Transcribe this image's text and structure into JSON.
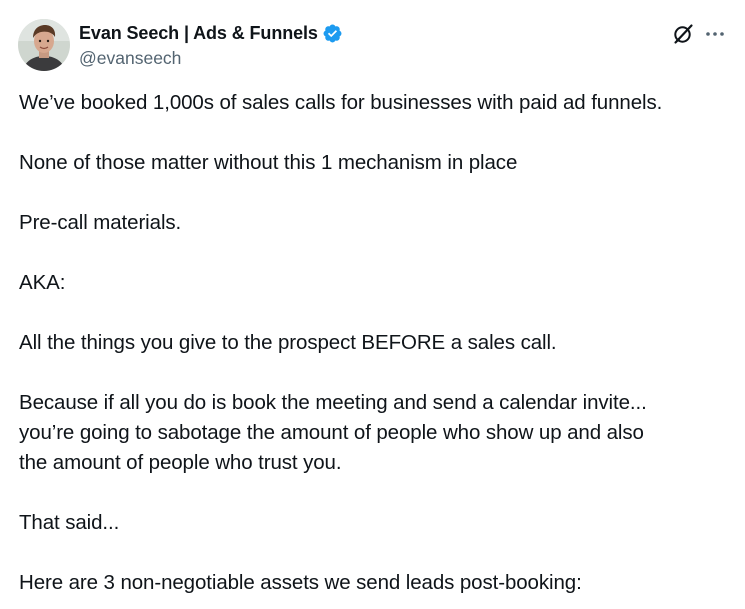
{
  "author": {
    "display_name": "Evan Seech | Ads & Funnels",
    "handle": "@evanseech",
    "verified": true,
    "avatar_icon": "avatar-photo",
    "verified_color": "#1d9bf0"
  },
  "actions": {
    "grok_icon": "grok-icon",
    "more_icon": "more-options-icon"
  },
  "body": {
    "p1": "We’ve booked 1,000s of sales calls for businesses with paid ad funnels.",
    "p2": "None of those matter without this 1 mechanism in place",
    "p3": "Pre-call materials.",
    "p4": "AKA:",
    "p5": "All the things you give to the prospect BEFORE a sales call.",
    "p6_line1": "Because if all you do is book the meeting and send a calendar invite...",
    "p6_line2": "you’re going to sabotage the amount of people who show up and also",
    "p6_line3": "the amount of people who trust you.",
    "p7": "That said...",
    "p8": "Here are 3 non-negotiable assets we send leads post-booking:"
  },
  "colors": {
    "text": "#0f1419",
    "secondary": "#536471"
  }
}
